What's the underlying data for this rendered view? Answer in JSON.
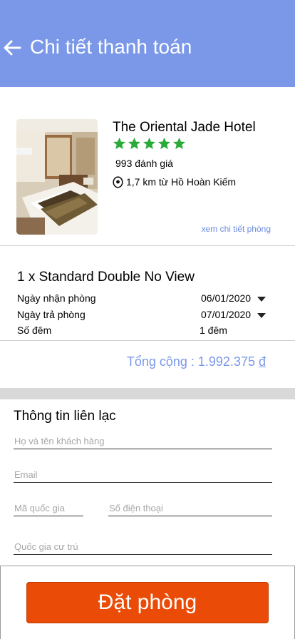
{
  "header": {
    "title": "Chi tiết thanh toán",
    "back_icon": "arrow-left-icon",
    "background_color": "#7b98e8"
  },
  "hotel": {
    "name": "The Oriental Jade Hotel",
    "star_rating": 5,
    "star_color": "#2aaa39",
    "reviews": "993 đánh giá",
    "distance": "1,7 km từ Hồ Hoàn Kiếm",
    "location_icon": "map-pin-icon",
    "room_details_link": "xem chi tiết phòng"
  },
  "booking": {
    "room": "1 x Standard Double No View",
    "checkin_label": "Ngày nhận phòng",
    "checkin_date": "06/01/2020",
    "checkout_label": "Ngày trả phòng",
    "checkout_date": "07/01/2020",
    "nights_label": "Số đêm",
    "nights_value": "1 đêm",
    "total_label": "Tổng cộng : 1.992.375",
    "total_currency": "đ"
  },
  "contact": {
    "title": "Thông tin liên lạc",
    "fullname_placeholder": "Họ và tên khách hàng",
    "email_placeholder": "Email",
    "country_code_placeholder": "Mã quốc gia",
    "phone_placeholder": "Số điện thoại",
    "residence_placeholder": "Quốc gia cư trú"
  },
  "footer": {
    "book_button": "Đặt phòng",
    "button_color": "#ea4b06"
  }
}
